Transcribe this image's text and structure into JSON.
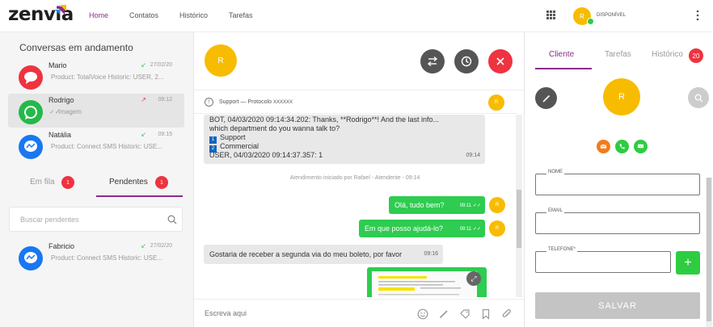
{
  "app": {
    "logo": "zenvia",
    "status": "DISPONÍVEL",
    "user_initial": "R"
  },
  "nav": {
    "items": [
      "Home",
      "Contatos",
      "Histórico",
      "Tarefas"
    ],
    "active": "Home"
  },
  "left": {
    "title": "Conversas em andamento",
    "conversations": [
      {
        "name": "Mario",
        "preview": "Product: TotalVoice Historic: USER, 2...",
        "date": "27/02/20",
        "channel": "chat-icon",
        "color": "#ef3340"
      },
      {
        "name": "Rodrigo",
        "preview": "Imagem",
        "date": "09:12",
        "channel": "whatsapp-icon",
        "color": "#25b84a"
      },
      {
        "name": "Natália",
        "preview": "Product: Connect SMS Historic: USE...",
        "date": "09:15",
        "channel": "messenger-icon",
        "color": "#1877f2"
      }
    ],
    "tabs": [
      {
        "label": "Em fila",
        "count": "1"
      },
      {
        "label": "Pendentes",
        "count": "1"
      }
    ],
    "search_placeholder": "Buscar pendentes",
    "pending": [
      {
        "name": "Fabricio",
        "preview": "Product: Connect SMS Historic: USE...",
        "date": "27/02/20",
        "channel": "messenger-icon",
        "color": "#1877f2"
      }
    ]
  },
  "chat": {
    "contact_initial": "R",
    "protocol_label": "Support — Protocolo",
    "protocol_value": "XXXXXX",
    "bot_message": {
      "lines": [
        "BOT, 04/03/2020 09:14:34.202: Thanks, **Rodrigo**! And the last info...",
        "which department do you wanna talk to?",
        "Support",
        "Commercial",
        "USER, 04/03/2020 09:14:37.357: 1"
      ],
      "option_numbers": [
        "1",
        "2"
      ],
      "time": "09:14"
    },
    "system_note": "Atendimento iniciado por Rafael - Atendente - 09:14",
    "outgoing": [
      {
        "text": "Olá, tudo bem?",
        "time": "09:11"
      },
      {
        "text": "Em que posso ajudá-lo?",
        "time": "09:11"
      }
    ],
    "incoming": {
      "text": "Gostaria de receber a segunda via do meu boleto, por favor",
      "time": "09:16"
    },
    "compose_placeholder": "Escreva aqui"
  },
  "right": {
    "tabs": [
      "Cliente",
      "Tarefas",
      "Histórico"
    ],
    "active_tab": "Cliente",
    "history_count": "20",
    "client_initial": "R",
    "fields": [
      "NOME",
      "EMAIL",
      "TELEFONE*"
    ],
    "save_label": "SALVAR"
  },
  "colors": {
    "brand": "#8a2b8c",
    "accent": "#f7bc00",
    "danger": "#ef3340",
    "success": "#2ecc50"
  }
}
